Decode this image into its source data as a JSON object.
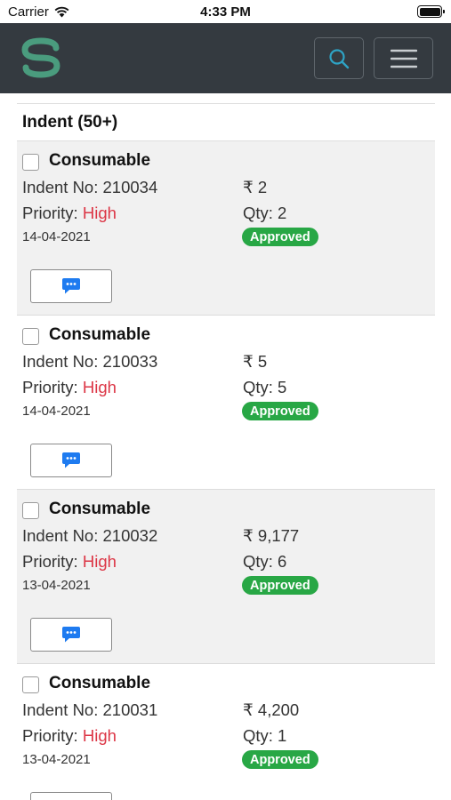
{
  "status_bar": {
    "carrier": "Carrier",
    "time": "4:33 PM",
    "wifi_icon": "wifi-icon",
    "battery_icon": "battery-icon"
  },
  "navbar": {
    "logo_icon": "s-logo-icon",
    "search_icon": "search-icon",
    "menu_icon": "hamburger-menu-icon"
  },
  "colors": {
    "navbar_bg": "#343a40",
    "logo": "#4a9c7e",
    "search_accent": "#2ea3c5",
    "priority_high": "#dc3545",
    "badge_approved": "#28a745",
    "comment_icon": "#1e7bf0",
    "card_shaded": "#f1f1f1"
  },
  "list": {
    "header": "Indent (50+)",
    "items": [
      {
        "category": "Consumable",
        "indent_no": "Indent No: 210034",
        "amount": "₹ 2",
        "priority_label": "Priority: ",
        "priority_value": "High",
        "qty": "Qty: 2",
        "date": "14-04-2021",
        "status": "Approved",
        "comment_icon": "comment-icon"
      },
      {
        "category": "Consumable",
        "indent_no": "Indent No: 210033",
        "amount": "₹ 5",
        "priority_label": "Priority: ",
        "priority_value": "High",
        "qty": "Qty: 5",
        "date": "14-04-2021",
        "status": "Approved",
        "comment_icon": "comment-icon"
      },
      {
        "category": "Consumable",
        "indent_no": "Indent No: 210032",
        "amount": "₹ 9,177",
        "priority_label": "Priority: ",
        "priority_value": "High",
        "qty": "Qty: 6",
        "date": "13-04-2021",
        "status": "Approved",
        "comment_icon": "comment-icon"
      },
      {
        "category": "Consumable",
        "indent_no": "Indent No: 210031",
        "amount": "₹ 4,200",
        "priority_label": "Priority: ",
        "priority_value": "High",
        "qty": "Qty: 1",
        "date": "13-04-2021",
        "status": "Approved",
        "comment_icon": "comment-icon"
      }
    ]
  }
}
